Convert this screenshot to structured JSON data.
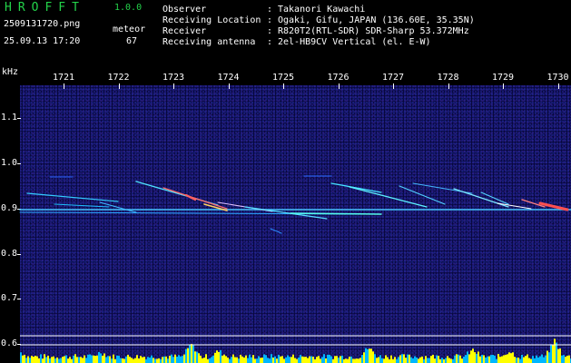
{
  "app": {
    "title": "HROFFT",
    "version": "1.0.0"
  },
  "file": {
    "name": "2509131720.png",
    "datetime": "25.09.13 17:20"
  },
  "meteor": {
    "label": "meteor",
    "count": "67"
  },
  "info": [
    {
      "key": "Observer",
      "value": "Takanori Kawachi"
    },
    {
      "key": "Receiving Location",
      "value": "Ogaki, Gifu, JAPAN (136.60E, 35.35N)"
    },
    {
      "key": "Receiver",
      "value": "R820T2(RTL-SDR) SDR-Sharp 53.372MHz"
    },
    {
      "key": "Receiving antenna",
      "value": "2el-HB9CV Vertical (el. E-W)"
    }
  ],
  "colon": ":",
  "spectrogram": {
    "y_unit": "kHz",
    "y_ticks": [
      "1.1",
      "1.0",
      "0.9",
      "0.8",
      "0.7",
      "0.6"
    ],
    "x_ticks": [
      "1721",
      "1722",
      "1723",
      "1724",
      "1725",
      "1726",
      "1727",
      "1728",
      "1729",
      "1730"
    ],
    "baseline_color": "#ffffff",
    "trace_color": "#00e0ff",
    "bar_color_high": "#ffff00",
    "bar_color_low": "#00b7ff"
  }
}
